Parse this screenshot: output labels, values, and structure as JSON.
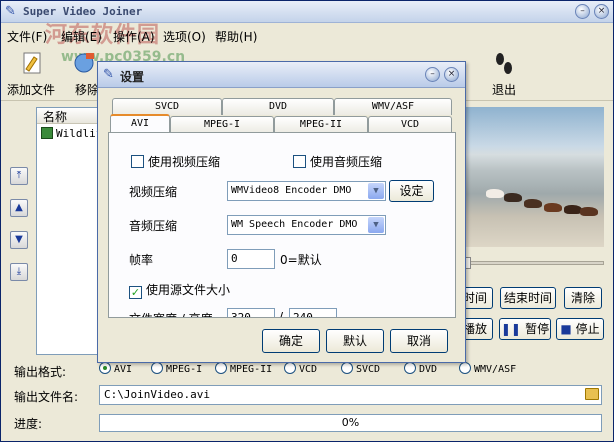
{
  "window": {
    "title": "Super Video Joiner",
    "watermark": "河东软件园",
    "watermark_url": "www.pc0359.cn"
  },
  "menu": [
    "文件(F)",
    "编辑(E)",
    "操作(A)",
    "选项(O)",
    "帮助(H)"
  ],
  "toolbar": {
    "add_file": "添加文件",
    "remove": "移除",
    "exit": "退出"
  },
  "filelist": {
    "header": "名称",
    "rows": [
      "Wildlif"
    ]
  },
  "controls": {
    "time_label": "时间",
    "end_time": "结束时间",
    "clear": "清除",
    "play": "播放",
    "pause": "暂停",
    "stop": "停止"
  },
  "output": {
    "format_label": "输出格式:",
    "formats": [
      "AVI",
      "MPEG-I",
      "MPEG-II",
      "VCD",
      "SVCD",
      "DVD",
      "WMV/ASF"
    ],
    "selected_format": "AVI",
    "filename_label": "输出文件名:",
    "filename": "C:\\JoinVideo.avi",
    "progress_label": "进度:",
    "progress_text": "0%",
    "progress": 0
  },
  "dialog": {
    "title": "设置",
    "tabs_back": [
      "SVCD",
      "DVD",
      "WMV/ASF"
    ],
    "tabs_front": [
      "AVI",
      "MPEG-I",
      "MPEG-II",
      "VCD"
    ],
    "active_tab": "AVI",
    "use_video_compress": "使用视频压缩",
    "use_audio_compress": "使用音频压缩",
    "video_compress_label": "视频压缩",
    "video_codec": "WMVideo8 Encoder DMO",
    "settings_button": "设定",
    "audio_compress_label": "音频压缩",
    "audio_codec": "WM Speech Encoder DMO",
    "frame_rate_label": "帧率",
    "frame_rate_value": "0",
    "frame_rate_hint": "0=默认",
    "use_source_size": "使用源文件大小",
    "size_label": "文件宽度 / 高度",
    "width_value": "320",
    "height_value": "240",
    "ok": "确定",
    "default": "默认",
    "cancel": "取消"
  },
  "colors": {
    "window_bg": "#ece9d8",
    "accent_tab": "#e68b2c",
    "border_blue": "#7f9db9"
  }
}
